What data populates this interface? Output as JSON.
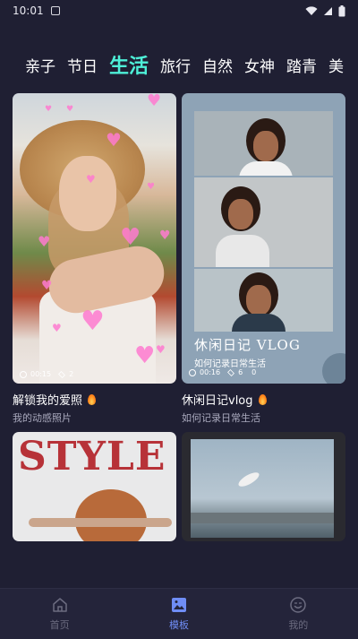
{
  "status_bar": {
    "time": "10:01"
  },
  "tabs": [
    {
      "label": "亲子",
      "active": false
    },
    {
      "label": "节日",
      "active": false
    },
    {
      "label": "生活",
      "active": true
    },
    {
      "label": "旅行",
      "active": false
    },
    {
      "label": "自然",
      "active": false
    },
    {
      "label": "女神",
      "active": false
    },
    {
      "label": "踏青",
      "active": false
    },
    {
      "label": "美",
      "active": false
    }
  ],
  "cards": [
    {
      "title": "解锁我的爱照",
      "subtitle": "我的动感照片",
      "duration": "00:15",
      "layers": "2",
      "hot": true
    },
    {
      "title": "休闲日记vlog",
      "subtitle": "如何记录日常生活",
      "duration": "00:16",
      "layers": "6",
      "extra": "0",
      "hot": true,
      "overlay_title": "休闲日记 VLOG",
      "overlay_subtitle": "如何记录日常生活"
    },
    {
      "overlay_title": "STYLE"
    },
    {}
  ],
  "bottom_nav": [
    {
      "label": "首页",
      "icon": "home-icon",
      "active": false
    },
    {
      "label": "模板",
      "icon": "template-icon",
      "active": true
    },
    {
      "label": "我的",
      "icon": "profile-icon",
      "active": false
    }
  ],
  "colors": {
    "background": "#1f1f33",
    "active_tab": "#4ef0d8",
    "active_nav": "#6f8df5",
    "inactive_nav": "#6c6c80"
  }
}
